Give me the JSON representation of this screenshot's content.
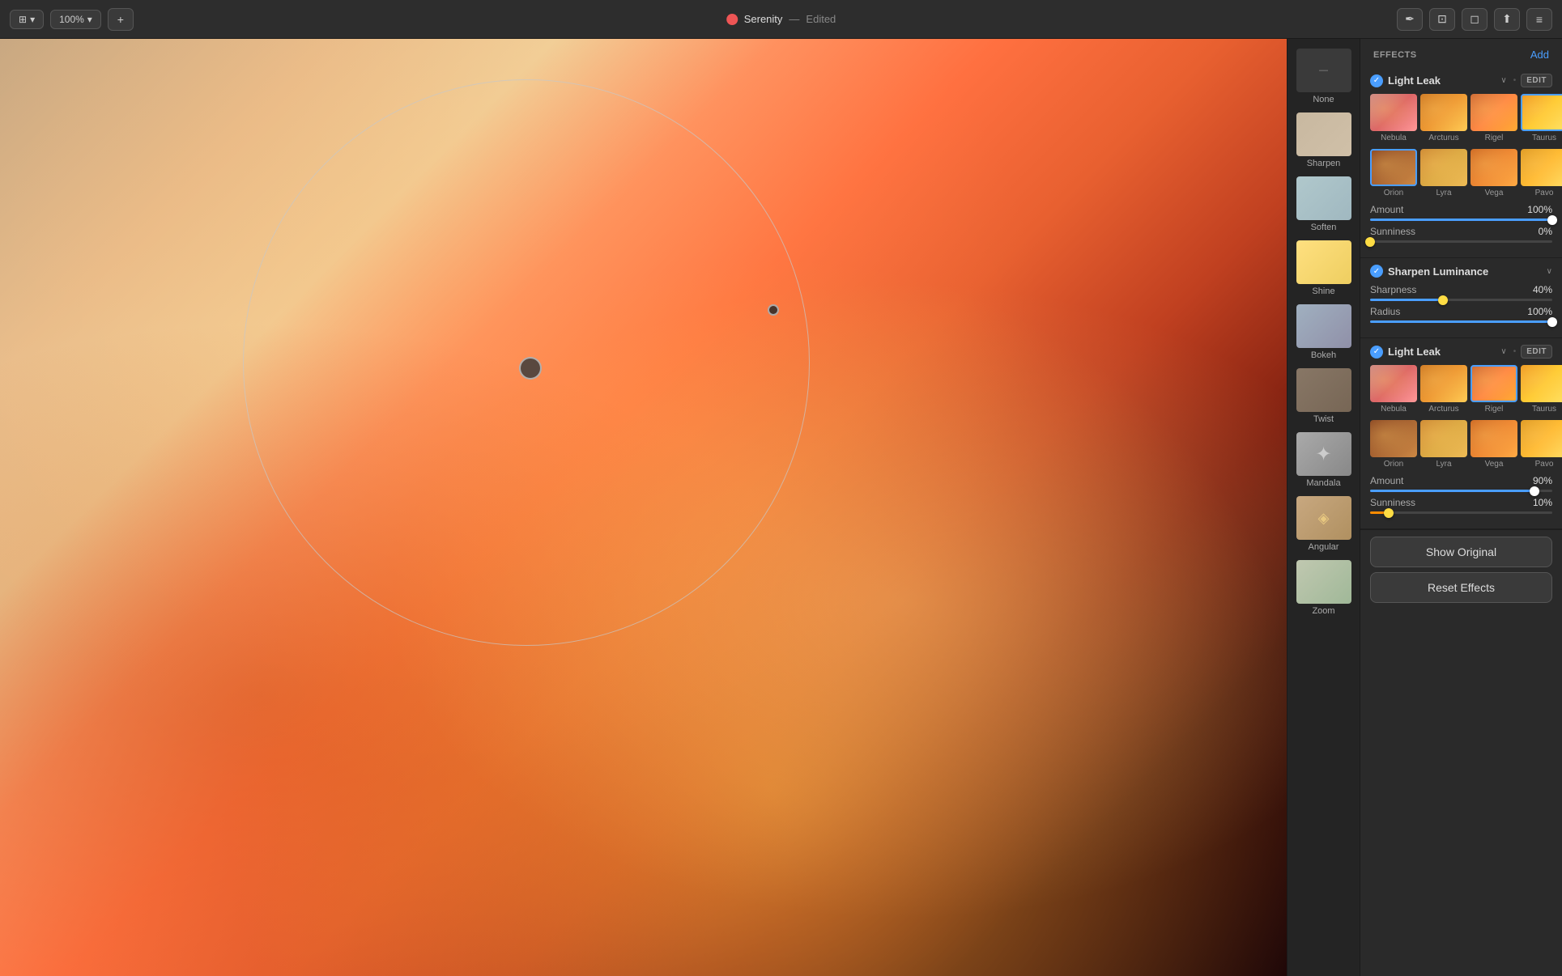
{
  "toolbar": {
    "zoom_label": "100%",
    "plus_label": "+",
    "title": "Serenity",
    "separator": "—",
    "edited_label": "Edited"
  },
  "effects": {
    "section_title": "EFFECTS",
    "add_label": "Add",
    "light_leak_1": {
      "name": "Light Leak",
      "chevron": "∨",
      "edit_label": "EDIT",
      "enabled": true,
      "presets": [
        {
          "name": "Nebula",
          "class": "ll-nebula"
        },
        {
          "name": "Arcturus",
          "class": "ll-arcturus"
        },
        {
          "name": "Rigel",
          "class": "ll-rigel",
          "selected": false
        },
        {
          "name": "Taurus",
          "class": "ll-taurus",
          "selected": true
        }
      ],
      "row2_presets": [
        {
          "name": "Orion",
          "class": "ll-orion",
          "selected": true
        },
        {
          "name": "Lyra",
          "class": "ll-lyra"
        },
        {
          "name": "Vega",
          "class": "ll-vega"
        },
        {
          "name": "Pavo",
          "class": "ll-pavo"
        }
      ],
      "amount_label": "Amount",
      "amount_value": "100%",
      "amount_fill": "100%",
      "sunniness_label": "Sunniness",
      "sunniness_value": "0%",
      "sunniness_fill": "0%"
    },
    "sharpen_luminance": {
      "name": "Sharpen Luminance",
      "chevron": "∨",
      "enabled": true,
      "sharpness_label": "Sharpness",
      "sharpness_value": "40%",
      "sharpness_fill": "40%",
      "radius_label": "Radius",
      "radius_value": "100%",
      "radius_fill": "100%"
    },
    "light_leak_2": {
      "name": "Light Leak",
      "chevron": "∨",
      "edit_label": "EDIT",
      "enabled": true,
      "presets": [
        {
          "name": "Nebula",
          "class": "ll-nebula"
        },
        {
          "name": "Arcturus",
          "class": "ll-arcturus"
        },
        {
          "name": "Rigel",
          "class": "ll-rigel",
          "selected": true
        },
        {
          "name": "Taurus",
          "class": "ll-taurus"
        }
      ],
      "row2_presets": [
        {
          "name": "Orion",
          "class": "ll-orion"
        },
        {
          "name": "Lyra",
          "class": "ll-lyra"
        },
        {
          "name": "Vega",
          "class": "ll-vega"
        },
        {
          "name": "Pavo",
          "class": "ll-pavo"
        }
      ],
      "amount_label": "Amount",
      "amount_value": "90%",
      "amount_fill": "90%",
      "sunniness_label": "Sunniness",
      "sunniness_value": "10%",
      "sunniness_fill": "10%"
    }
  },
  "thumbnails": [
    {
      "label": "None",
      "class": "img-none"
    },
    {
      "label": "Sharpen",
      "class": "img-sharpen"
    },
    {
      "label": "Soften",
      "class": "img-soften"
    },
    {
      "label": "Shine",
      "class": "img-shine"
    },
    {
      "label": "Bokeh",
      "class": "img-bokeh"
    },
    {
      "label": "Twist",
      "class": "img-twist"
    },
    {
      "label": "Mandala",
      "class": "img-mandala"
    },
    {
      "label": "Angular",
      "class": "img-angular"
    },
    {
      "label": "Zoom",
      "class": "img-zoom"
    }
  ],
  "right_icons": [
    {
      "name": "pen-icon",
      "glyph": "✏️"
    },
    {
      "name": "crop-icon",
      "glyph": "⊞"
    },
    {
      "name": "stamp-icon",
      "glyph": "◻"
    },
    {
      "name": "share-icon",
      "glyph": "↑"
    },
    {
      "name": "adjust-icon",
      "glyph": "≡"
    }
  ],
  "bottom_buttons": {
    "show_original": "Show Original",
    "reset_effects": "Reset Effects"
  }
}
